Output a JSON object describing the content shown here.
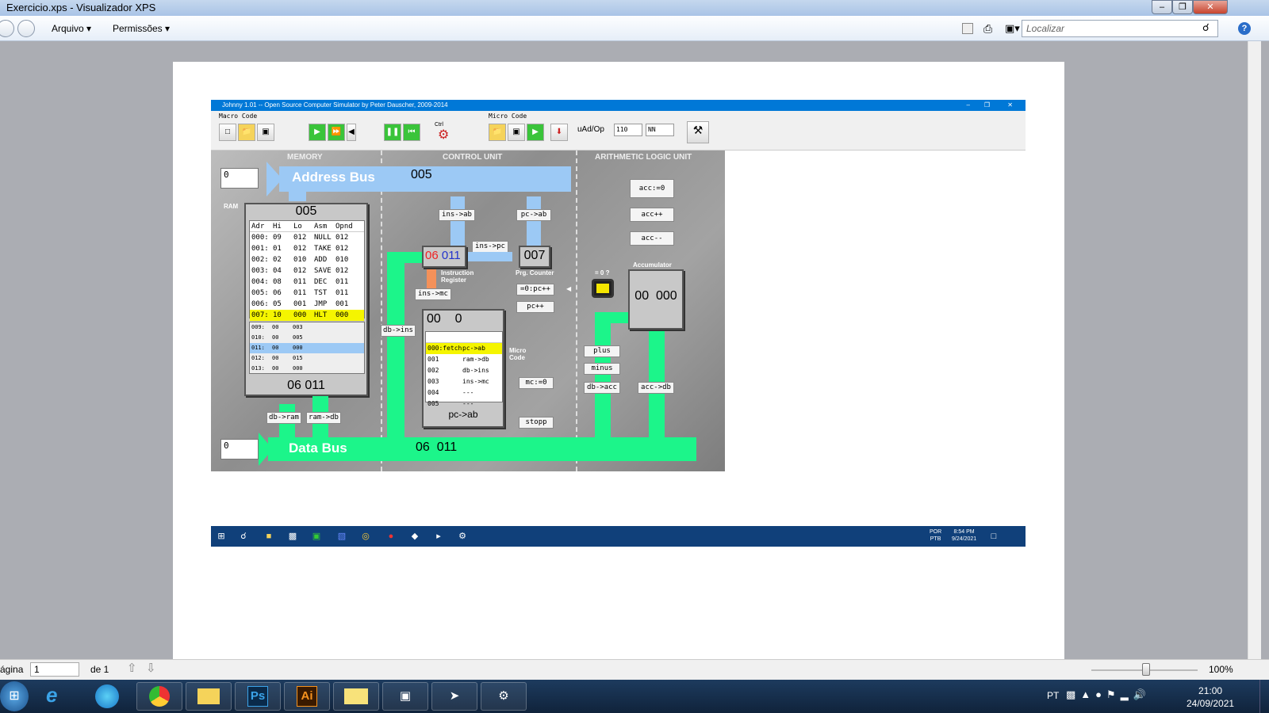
{
  "window": {
    "title": "Exercicio.xps - Visualizador XPS",
    "menu": [
      "Arquivo",
      "Permissões"
    ],
    "search_placeholder": "Localizar"
  },
  "status": {
    "page_label": "ágina",
    "page_value": "1",
    "of_label": "de 1",
    "zoom": "100%"
  },
  "win7_taskbar": {
    "lang": "PT",
    "time": "21:00",
    "date": "24/09/2021",
    "apps": [
      "Ps",
      "Ai"
    ]
  },
  "johnny": {
    "title": "Johnny 1.01 -- Open Source Computer Simulator by Peter Dauscher, 2009-2014",
    "toolbar": {
      "macro_label": "Macro Code",
      "micro_label": "Micro Code",
      "uad_label": "uAd/Op",
      "uad_value": "110",
      "nn_value": "NN",
      "ctrl_label": "Ctrl"
    },
    "sections": {
      "memory": "MEMORY",
      "control": "CONTROL UNIT",
      "alu": "ARITHMETIC LOGIC UNIT"
    },
    "address_bus": {
      "label": "Address Bus",
      "value": "005",
      "input": "0"
    },
    "data_bus": {
      "label": "Data Bus",
      "value": "06  011",
      "input": "0"
    },
    "ram": {
      "label": "RAM",
      "address": "005",
      "value": "06  011",
      "headers": [
        "Adr",
        "Hi",
        "Lo",
        "Asm",
        "Opnd"
      ],
      "rows": [
        [
          "000:",
          "09",
          "012",
          "NULL",
          "012"
        ],
        [
          "001:",
          "01",
          "012",
          "TAKE",
          "012"
        ],
        [
          "002:",
          "02",
          "010",
          "ADD",
          "010"
        ],
        [
          "003:",
          "04",
          "012",
          "SAVE",
          "012"
        ],
        [
          "004:",
          "08",
          "011",
          "DEC",
          "011"
        ],
        [
          "005:",
          "06",
          "011",
          "TST",
          "011"
        ],
        [
          "006:",
          "05",
          "001",
          "JMP",
          "001"
        ],
        [
          "007:",
          "10",
          "000",
          "HLT",
          "000"
        ]
      ],
      "rows2": [
        [
          "009:",
          "00",
          "003"
        ],
        [
          "010:",
          "00",
          "005"
        ],
        [
          "011:",
          "00",
          "000"
        ],
        [
          "012:",
          "00",
          "015"
        ],
        [
          "013:",
          "00",
          "000"
        ]
      ]
    },
    "control": {
      "ir_hi": "06",
      "ir_lo": "011",
      "ir_label": "Instruction Register",
      "pc": "007",
      "pc_label": "Prg. Counter",
      "mc_hi": "00",
      "mc_lo": "0",
      "mc_label": "Micro Code",
      "mc_current": "pc->ab",
      "micro_rows": [
        [
          "000:fetch",
          "pc->ab"
        ],
        [
          "001",
          "ram->db"
        ],
        [
          "002",
          "db->ins"
        ],
        [
          "003",
          "ins->mc"
        ],
        [
          "004",
          "---"
        ],
        [
          "005",
          "---"
        ]
      ]
    },
    "buttons": {
      "ins_ab": "ins->ab",
      "pc_ab": "pc->ab",
      "ins_pc": "ins->pc",
      "ins_mc": "ins->mc",
      "zero_pc": "=0:pc++",
      "pc_inc": "pc++",
      "mc_zero": "mc:=0",
      "stopp": "stopp",
      "db_ins": "db->ins",
      "db_ram": "db->ram",
      "ram_db": "ram->db",
      "acc0": "acc:=0",
      "accinc": "acc++",
      "accdec": "acc--",
      "plus": "plus",
      "minus": "minus",
      "db_acc": "db->acc",
      "acc_db": "acc->db"
    },
    "alu": {
      "zero_label": "= 0 ?",
      "acc_label": "Accumulator",
      "acc_value": "00  000"
    },
    "taskbar": {
      "lang1": "POR",
      "lang2": "PTB",
      "time": "8:54 PM",
      "date": "9/24/2021"
    }
  }
}
